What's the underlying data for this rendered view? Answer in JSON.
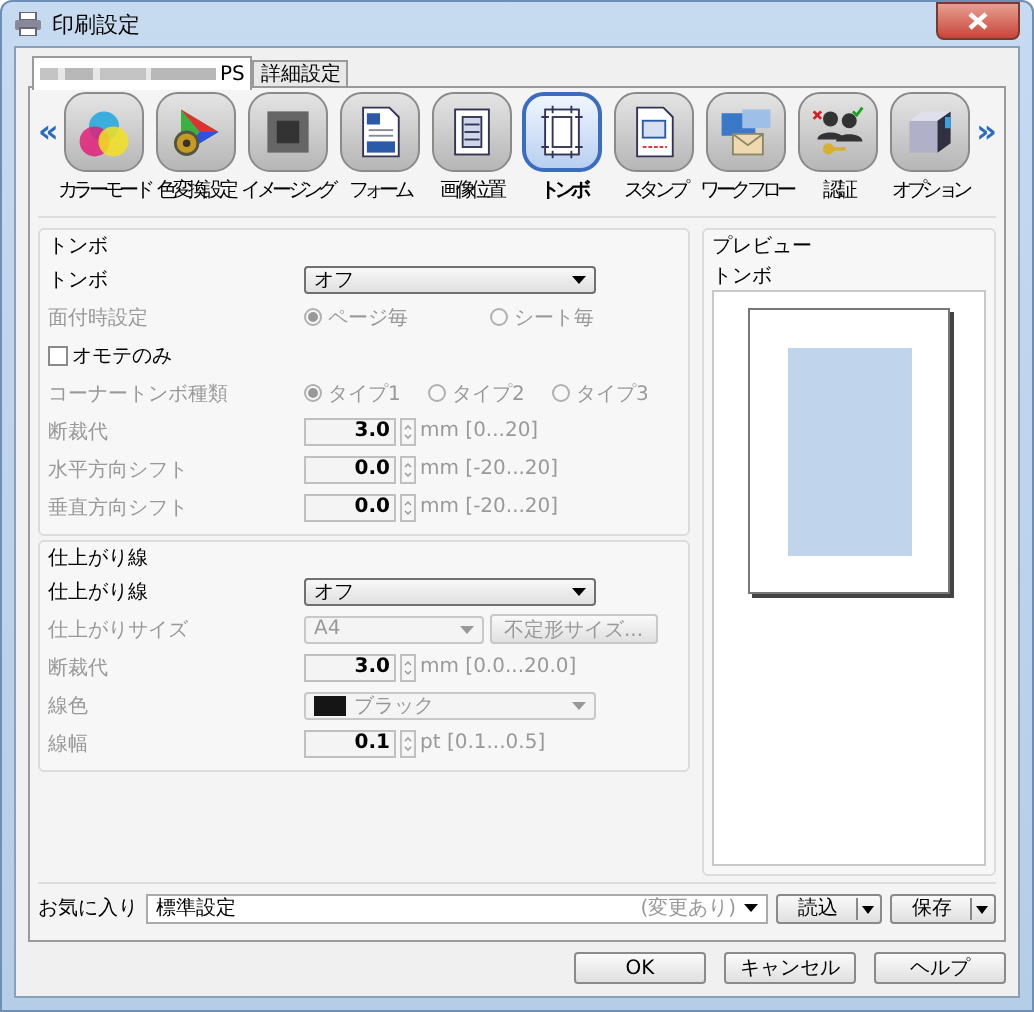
{
  "window": {
    "title": "印刷設定"
  },
  "tabs": [
    {
      "label": "PS",
      "selected": true
    },
    {
      "label": "詳細設定",
      "selected": false
    }
  ],
  "toolbar": {
    "prev": "«",
    "next": "»",
    "items": [
      {
        "label": "カラーモード",
        "kind": "color-mode",
        "selected": false
      },
      {
        "label": "色変換設定",
        "kind": "color-conversion",
        "selected": false
      },
      {
        "label": "イメージング",
        "kind": "imaging",
        "selected": false
      },
      {
        "label": "フォーム",
        "kind": "form",
        "selected": false
      },
      {
        "label": "画像位置",
        "kind": "image-position",
        "selected": false
      },
      {
        "label": "トンボ",
        "kind": "trim-marks",
        "selected": true
      },
      {
        "label": "スタンプ",
        "kind": "stamp",
        "selected": false
      },
      {
        "label": "ワークフロー",
        "kind": "workflow",
        "selected": false
      },
      {
        "label": "認証",
        "kind": "auth",
        "selected": false
      },
      {
        "label": "オプション",
        "kind": "option",
        "selected": false
      }
    ]
  },
  "sections": [
    {
      "title": "トンボ",
      "rows": [
        {
          "kind": "select",
          "label": "トンボ",
          "value": "オフ",
          "disabled": false
        },
        {
          "kind": "radio",
          "label": "面付時設定",
          "disabled": true,
          "options": [
            {
              "label": "ページ毎",
              "selected": true
            },
            {
              "label": "シート毎",
              "selected": false
            }
          ]
        },
        {
          "kind": "checkbox",
          "label": "オモテのみ",
          "checked": false,
          "disabled": false
        },
        {
          "kind": "radio",
          "label": "コーナートンボ種類",
          "disabled": true,
          "options": [
            {
              "label": "タイプ1",
              "selected": true
            },
            {
              "label": "タイプ2",
              "selected": false
            },
            {
              "label": "タイプ3",
              "selected": false
            }
          ]
        },
        {
          "kind": "spin",
          "label": "断裁代",
          "value": "3.0",
          "unit": "mm [0...20]",
          "disabled": true
        },
        {
          "kind": "spin",
          "label": "水平方向シフト",
          "value": "0.0",
          "unit": "mm [-20...20]",
          "disabled": true
        },
        {
          "kind": "spin",
          "label": "垂直方向シフト",
          "value": "0.0",
          "unit": "mm [-20...20]",
          "disabled": true
        }
      ]
    },
    {
      "title": "仕上がり線",
      "rows": [
        {
          "kind": "select",
          "label": "仕上がり線",
          "value": "オフ",
          "disabled": false
        },
        {
          "kind": "select-button",
          "label": "仕上がりサイズ",
          "value": "A4",
          "button": "不定形サイズ...",
          "disabled": true
        },
        {
          "kind": "spin",
          "label": "断裁代",
          "value": "3.0",
          "unit": "mm [0.0...20.0]",
          "disabled": true
        },
        {
          "kind": "color-select",
          "label": "線色",
          "value": "ブラック",
          "disabled": true
        },
        {
          "kind": "spin",
          "label": "線幅",
          "value": "0.1",
          "unit": "pt [0.1...0.5]",
          "disabled": true
        }
      ]
    }
  ],
  "preview": {
    "title": "プレビュー",
    "label": "トンボ"
  },
  "favorites": {
    "label": "お気に入り",
    "value": "標準設定",
    "note": "(変更あり)",
    "buttons": [
      "読込",
      "保存"
    ]
  },
  "buttons": [
    "OK",
    "キャンセル",
    "ヘルプ"
  ]
}
